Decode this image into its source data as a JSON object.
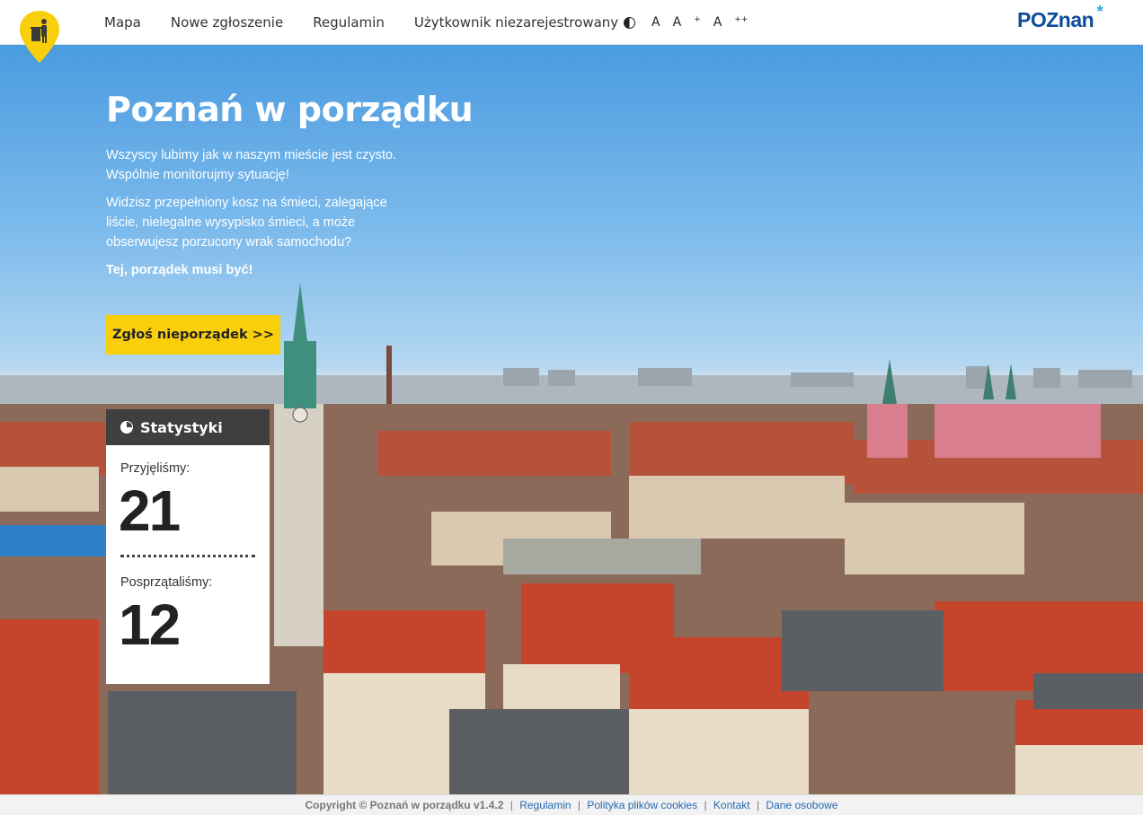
{
  "nav": {
    "items": [
      "Mapa",
      "Nowe zgłoszenie",
      "Regulamin"
    ],
    "user_menu": "Użytkownik niezarejestrowany",
    "a11y": {
      "font_normal": "A",
      "font_large": "A",
      "font_large_sup": "+",
      "font_xlarge": "A",
      "font_xlarge_sup": "++"
    },
    "brand": "POZnan"
  },
  "hero": {
    "title": "Poznań w porządku",
    "p1": "Wszyscy lubimy jak w naszym mieście jest czysto. Wspólnie monitorujmy sytuację!",
    "p2": "Widzisz przepełniony kosz na śmieci, zalegające liście, nielegalne wysypisko śmieci, a może obserwujesz porzucony wrak samochodu?",
    "p3": "Tej, porządek musi być!",
    "cta": "Zgłoś nieporządek >>"
  },
  "stats": {
    "title": "Statystyki",
    "accepted_label": "Przyjęliśmy:",
    "accepted_value": "21",
    "cleaned_label": "Posprzątaliśmy:",
    "cleaned_value": "12"
  },
  "footer": {
    "copyright": "Copyright © Poznań w porządku v1.4.2",
    "links": [
      "Regulamin",
      "Polityka plików cookies",
      "Kontakt",
      "Dane osobowe"
    ]
  },
  "colors": {
    "accent": "#f9cf0c",
    "stats_header": "#3f3f3f",
    "brand": "#0f4c9a",
    "link": "#2668b0"
  }
}
